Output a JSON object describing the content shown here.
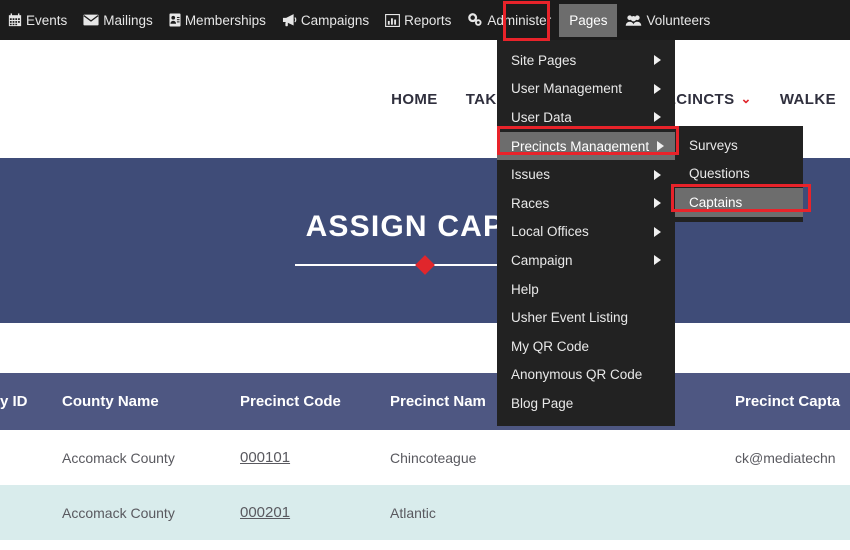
{
  "topbar": {
    "items": [
      {
        "label": "Events",
        "icon": "calendar-icon"
      },
      {
        "label": "Mailings",
        "icon": "envelope-icon"
      },
      {
        "label": "Memberships",
        "icon": "id-card-icon"
      },
      {
        "label": "Campaigns",
        "icon": "megaphone-icon"
      },
      {
        "label": "Reports",
        "icon": "bar-chart-icon"
      },
      {
        "label": "Administer",
        "icon": "gears-icon"
      },
      {
        "label": "Pages",
        "icon": "none"
      },
      {
        "label": "Volunteers",
        "icon": "users-icon"
      }
    ]
  },
  "subnav": {
    "items": [
      {
        "label": "HOME",
        "chevron": false
      },
      {
        "label": "TAKE ACTION",
        "chevron": false
      },
      {
        "label": "",
        "chevron": true
      },
      {
        "label": "PRECINCTS",
        "chevron": true
      },
      {
        "label": "WALKE",
        "chevron": false
      }
    ],
    "chevron_glyph": "⌄"
  },
  "banner": {
    "title": "ASSIGN CAPTA"
  },
  "menu": {
    "items": [
      {
        "label": "Site Pages",
        "submenu": true,
        "selected": false
      },
      {
        "label": "User Management",
        "submenu": true,
        "selected": false
      },
      {
        "label": "User Data",
        "submenu": true,
        "selected": false
      },
      {
        "label": "Precincts Management",
        "submenu": true,
        "selected": true
      },
      {
        "label": "Issues",
        "submenu": true,
        "selected": false
      },
      {
        "label": "Races",
        "submenu": true,
        "selected": false
      },
      {
        "label": "Local Offices",
        "submenu": true,
        "selected": false
      },
      {
        "label": "Campaign",
        "submenu": true,
        "selected": false
      },
      {
        "label": "Help",
        "submenu": false,
        "selected": false
      },
      {
        "label": "Usher Event Listing",
        "submenu": false,
        "selected": false
      },
      {
        "label": "My QR Code",
        "submenu": false,
        "selected": false
      },
      {
        "label": "Anonymous QR Code",
        "submenu": false,
        "selected": false
      },
      {
        "label": "Blog Page",
        "submenu": false,
        "selected": false
      }
    ]
  },
  "submenu": {
    "items": [
      {
        "label": "Surveys",
        "selected": false
      },
      {
        "label": "Questions",
        "selected": false
      },
      {
        "label": "Captains",
        "selected": true
      }
    ]
  },
  "table": {
    "columns": [
      "y ID",
      "County Name",
      "Precinct Code",
      "Precinct Nam",
      "Precinct Capta"
    ],
    "rows": [
      {
        "id": "",
        "county": "Accomack County",
        "code": "000101",
        "precinct": "Chincoteague",
        "captain": "ck@mediatechn",
        "alt": false
      },
      {
        "id": "",
        "county": "Accomack County",
        "code": "000201",
        "precinct": "Atlantic",
        "captain": "",
        "alt": true
      }
    ]
  },
  "colors": {
    "banner": "#3f4c78",
    "table_header": "#4e5782",
    "alt_row": "#d9ecec",
    "highlight_red": "#e8232a",
    "accent_red": "#e0262c",
    "menu_bg": "#222222",
    "menu_selected": "#6d6d6d"
  }
}
